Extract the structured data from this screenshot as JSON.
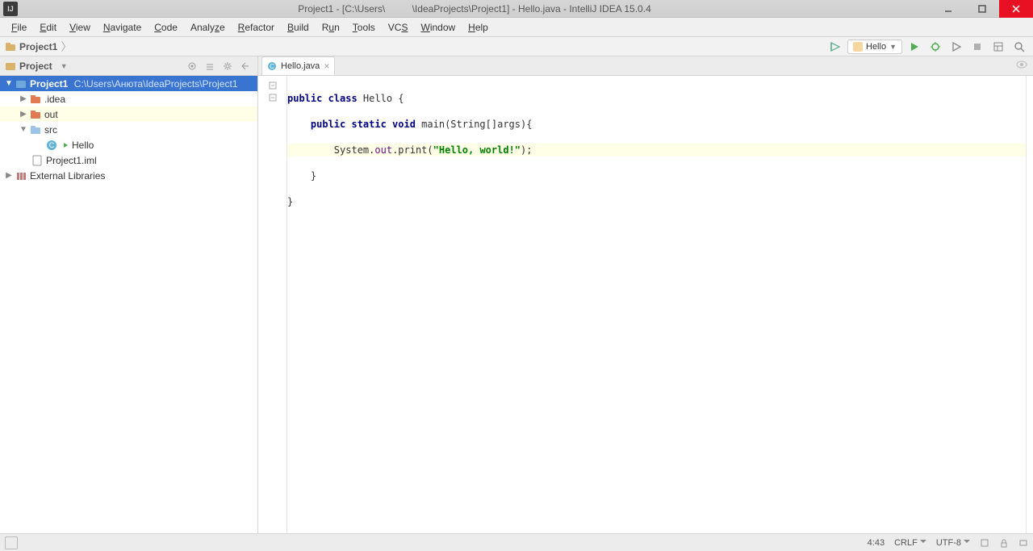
{
  "title": "Project1 - [C:\\Users\\          \\IdeaProjects\\Project1] - Hello.java - IntelliJ IDEA 15.0.4",
  "menu": [
    "File",
    "Edit",
    "View",
    "Navigate",
    "Code",
    "Analyze",
    "Refactor",
    "Build",
    "Run",
    "Tools",
    "VCS",
    "Window",
    "Help"
  ],
  "breadcrumb": {
    "root": "Project1"
  },
  "run_config": {
    "label": "Hello"
  },
  "project_panel": {
    "title": "Project"
  },
  "tree": {
    "project": {
      "name": "Project1",
      "path": "C:\\Users\\Анюта\\IdeaProjects\\Project1"
    },
    "idea": ".idea",
    "out": "out",
    "src": "src",
    "hello_class": "Hello",
    "iml": "Project1.iml",
    "ext": "External Libraries"
  },
  "tab": {
    "name": "Hello.java"
  },
  "code": {
    "l1_a": "public class ",
    "l1_b": "Hello {",
    "l2_a": "    public static void ",
    "l2_b": "main(String[]args){",
    "l3_a": "        System.",
    "l3_out": "out",
    "l3_b": ".print(",
    "l3_str": "\"Hello, world!\"",
    "l3_c": ");",
    "l4": "    }",
    "l5": "}"
  },
  "status": {
    "pos": "4:43",
    "lineend": "CRLF",
    "enc": "UTF-8"
  }
}
